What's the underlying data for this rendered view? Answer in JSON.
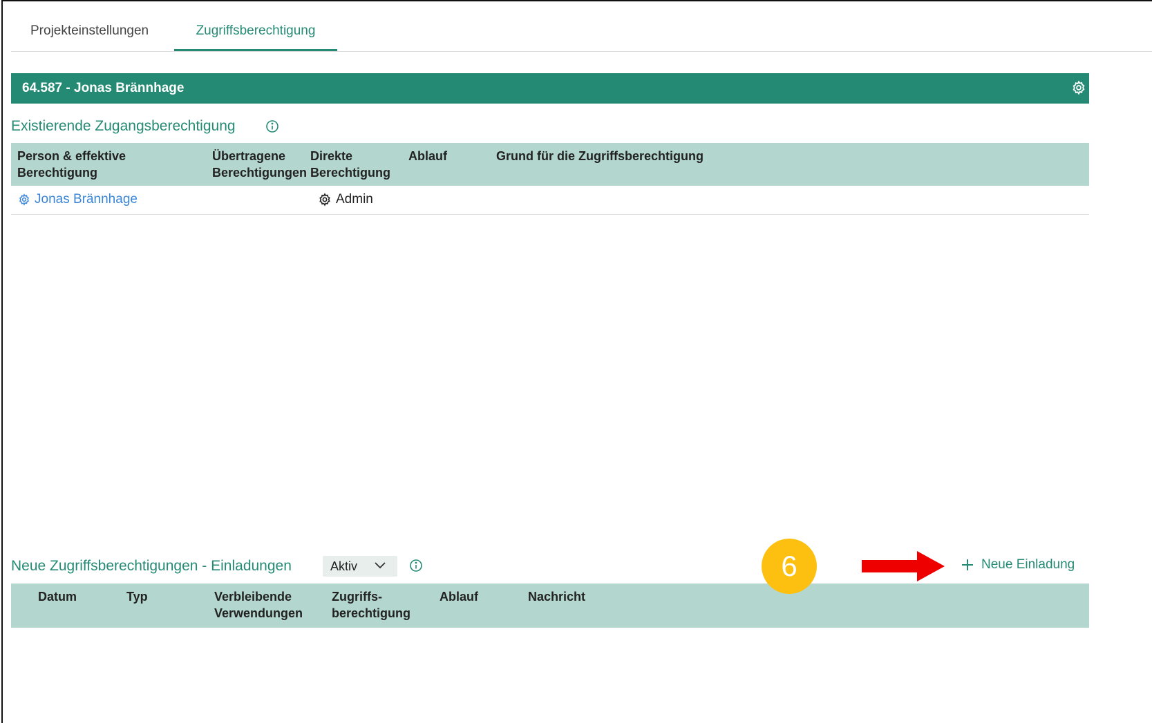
{
  "tabs": [
    {
      "label": "Projekteinstellungen"
    },
    {
      "label": "Zugriffsberechtigung"
    }
  ],
  "project": {
    "header": "64.587 - Jonas Brännhage"
  },
  "existing": {
    "title": "Existierende Zugangsberechtigung",
    "columns": [
      {
        "line1": "Person & effektive",
        "line2": "Berechtigung"
      },
      {
        "line1": "Übertragene",
        "line2": "Berechtigungen"
      },
      {
        "line1": "Direkte",
        "line2": "Berechtigung"
      },
      {
        "line1": "Ablauf",
        "line2": ""
      },
      {
        "line1": "Grund für die Zugriffsberechtigung",
        "line2": ""
      }
    ],
    "rows": [
      {
        "person": "Jonas Brännhage",
        "direct": "Admin"
      }
    ]
  },
  "invitations": {
    "title": "Neue Zugriffsberechtigungen - Einladungen",
    "filter_value": "Aktiv",
    "new_button": "Neue Einladung",
    "columns": [
      {
        "line1": "Datum",
        "line2": ""
      },
      {
        "line1": "Typ",
        "line2": ""
      },
      {
        "line1": "Verbleibende",
        "line2": "Verwendungen"
      },
      {
        "line1": "Zugriffs-",
        "line2": "berechtigung"
      },
      {
        "line1": "Ablauf",
        "line2": ""
      },
      {
        "line1": "Nachricht",
        "line2": ""
      }
    ]
  },
  "annotation": {
    "step": "6"
  },
  "colors": {
    "accent": "#258a74",
    "table_header": "#b3d7ce",
    "badge": "#fec010",
    "arrow": "#ee0000",
    "link": "#3b86d6"
  }
}
